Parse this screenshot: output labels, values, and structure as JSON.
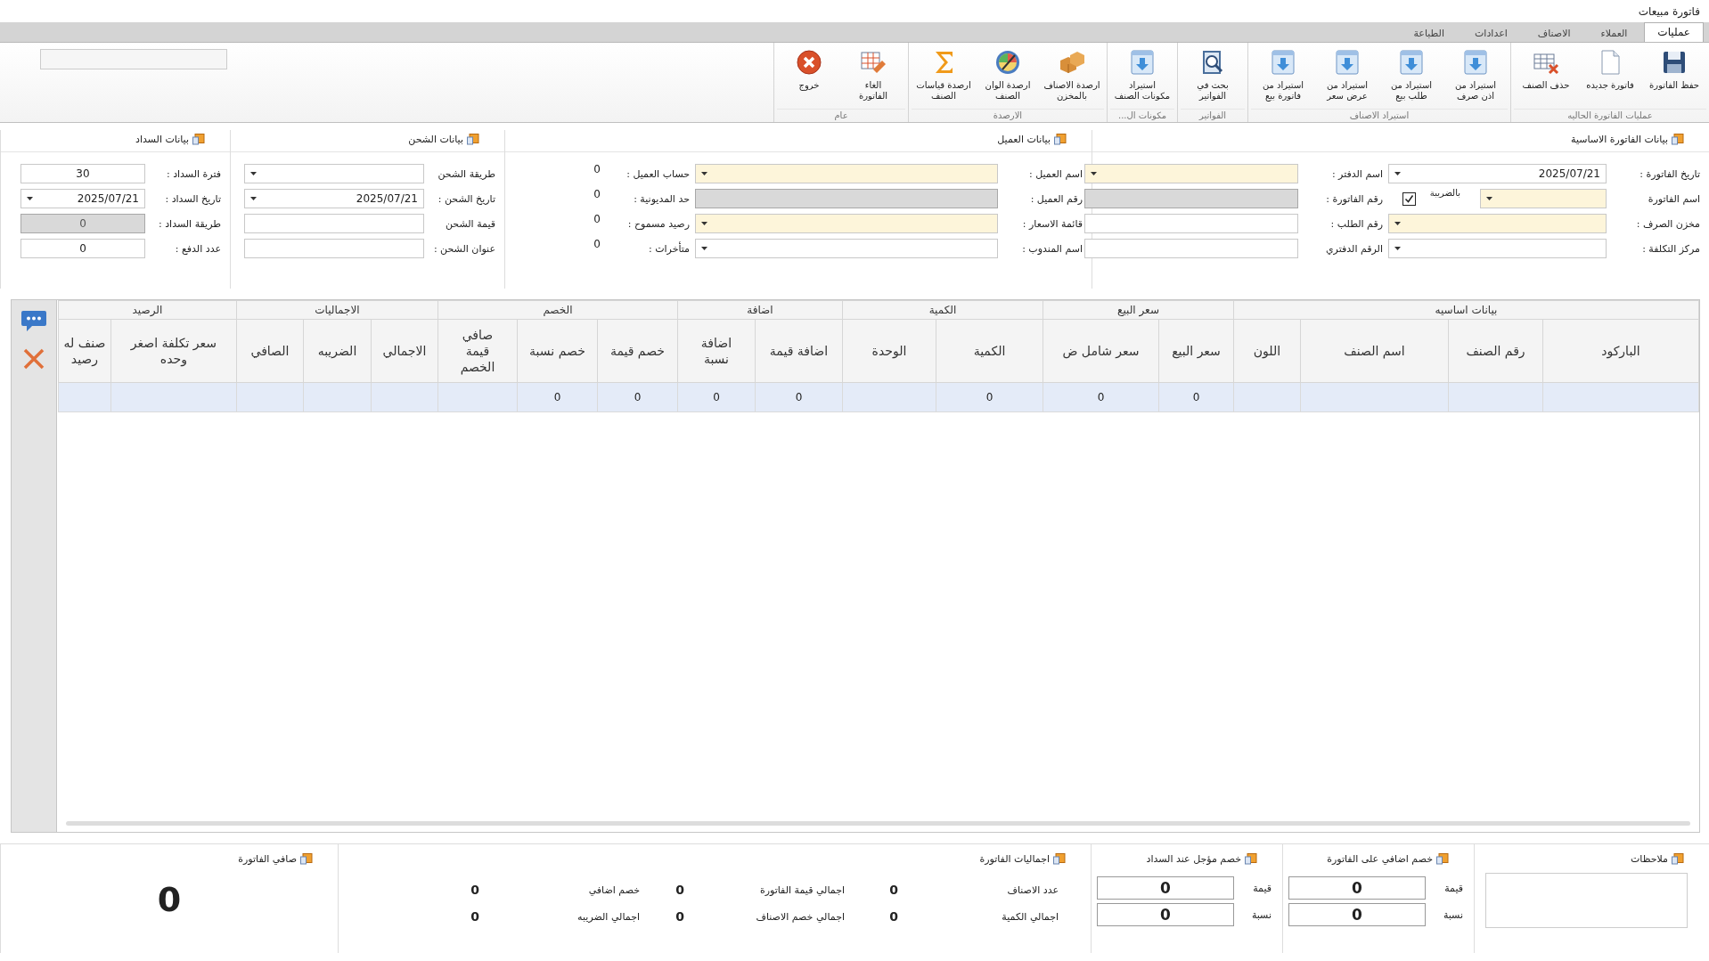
{
  "window": {
    "title": "فاتورة مبيعات"
  },
  "ribbon_tabs": [
    {
      "label": "عمليات",
      "selected": true
    },
    {
      "label": "العملاء",
      "selected": false
    },
    {
      "label": "الاصناف",
      "selected": false
    },
    {
      "label": "اعدادات",
      "selected": false
    },
    {
      "label": "الطباعة",
      "selected": false
    }
  ],
  "ribbon_groups": [
    {
      "label": "عمليات الفاتورة الحاليه",
      "buttons": [
        {
          "label": "حفظ الفاتورة",
          "kind": "save"
        },
        {
          "label": "فاتورة جديده",
          "kind": "new"
        },
        {
          "label": "حذف الصنف",
          "kind": "delete"
        }
      ]
    },
    {
      "label": "استيراد الاصناف",
      "buttons": [
        {
          "label": "استيراد من\nاذن صرف",
          "kind": "import"
        },
        {
          "label": "استيراد من\nطلب بيع",
          "kind": "import"
        },
        {
          "label": "استيراد من\nعرض سعر",
          "kind": "import"
        },
        {
          "label": "استيراد من\nفاتورة بيع",
          "kind": "import"
        }
      ]
    },
    {
      "label": "الفواتير",
      "buttons": [
        {
          "label": "بحث في\nالفواتير",
          "kind": "search"
        }
      ]
    },
    {
      "label": "مكونات ال...",
      "buttons": [
        {
          "label": "استيراد\nمكونات الصنف",
          "kind": "import"
        }
      ]
    },
    {
      "label": "الارصدة",
      "buttons": [
        {
          "label": "ارصدة الاصناف\nبالمخزن",
          "kind": "stock"
        },
        {
          "label": "ارصدة الوان\nالصنف",
          "kind": "colors"
        },
        {
          "label": "ارصدة قياسات\nالصنف",
          "kind": "sizes"
        }
      ]
    },
    {
      "label": "عام",
      "buttons": [
        {
          "label": "الغاء\nالفاتورة",
          "kind": "cancel"
        },
        {
          "label": "خروج",
          "kind": "exit"
        }
      ]
    }
  ],
  "invoice_basic": {
    "title": "بيانات الفاتورة الاساسية",
    "right_fields": [
      {
        "label": "تاريخ الفاتورة :",
        "kind": "dropdown",
        "value": "2025/07/21",
        "required": false,
        "disabled": false
      },
      {
        "label": "اسم الفاتورة",
        "kind": "dropdown",
        "required": true,
        "disabled": false,
        "tax": {
          "label": "بالضريبة",
          "checked": true
        }
      },
      {
        "label": "مخزن الصرف :",
        "kind": "dropdown",
        "required": true,
        "disabled": false
      },
      {
        "label": "مركز التكلفة :",
        "kind": "dropdown",
        "required": false,
        "disabled": false
      }
    ],
    "left_fields": [
      {
        "label": "اسم الدفتر :",
        "kind": "dropdown",
        "required": true,
        "disabled": false
      },
      {
        "label": "رقم الفاتورة :",
        "kind": "text",
        "required": false,
        "disabled": true
      },
      {
        "label": "رقم الطلب :",
        "kind": "text",
        "required": false,
        "disabled": false
      },
      {
        "label": "الرقم الدفتري",
        "kind": "text",
        "required": false,
        "disabled": false
      }
    ]
  },
  "customer": {
    "title": "بيانات العميل",
    "rows": [
      {
        "label": "اسم العميل :",
        "kind": "dropdown",
        "required": true,
        "disabled": false,
        "info_label": "حساب العميل :",
        "info_value": "0"
      },
      {
        "label": "رقم العميل :",
        "kind": "text",
        "required": false,
        "disabled": true,
        "info_label": "حد المديونية :",
        "info_value": "0"
      },
      {
        "label": "قائمة الاسعار :",
        "kind": "dropdown",
        "required": true,
        "disabled": false,
        "info_label": "رصيد مسموح :",
        "info_value": "0"
      },
      {
        "label": "اسم المندوب :",
        "kind": "dropdown",
        "required": false,
        "disabled": false,
        "info_label": "متأخرات :",
        "info_value": "0"
      }
    ]
  },
  "shipping": {
    "title": "بيانات الشحن",
    "fields": [
      {
        "label": "طريقة الشحن",
        "kind": "dropdown",
        "required": false,
        "disabled": false
      },
      {
        "label": "تاريخ الشحن :",
        "kind": "dropdown",
        "value": "2025/07/21",
        "required": false,
        "disabled": false
      },
      {
        "label": "قيمة الشحن",
        "kind": "text",
        "required": false,
        "disabled": false
      },
      {
        "label": "عنوان الشحن :",
        "kind": "text",
        "required": false,
        "disabled": false
      }
    ]
  },
  "payment": {
    "title": "بيانات السداد",
    "fields": [
      {
        "label": "فترة السداد :",
        "kind": "text",
        "value": "30",
        "required": false,
        "disabled": false
      },
      {
        "label": "تاريخ السداد :",
        "kind": "dropdown",
        "value": "2025/07/21",
        "required": false,
        "disabled": false
      },
      {
        "label": "طريقة السداد :",
        "kind": "text",
        "value": "0",
        "required": false,
        "disabled": true
      },
      {
        "label": "عدد الدفع :",
        "kind": "text",
        "value": "0",
        "required": false,
        "disabled": false
      }
    ]
  },
  "table": {
    "groups": [
      {
        "label": "بيانات اساسيه",
        "columns": [
          "الباركود",
          "رقم الصنف",
          "اسم الصنف",
          "اللون"
        ]
      },
      {
        "label": "سعر البيع",
        "columns": [
          "سعر البيع",
          "سعر شامل ض"
        ]
      },
      {
        "label": "الكمية",
        "columns": [
          "الكمية",
          "الوحدة"
        ]
      },
      {
        "label": "اضافة",
        "columns": [
          "اضافة قيمة",
          "اضافة\nنسبة"
        ]
      },
      {
        "label": "الخصم",
        "columns": [
          "خصم قيمة",
          "خصم نسبة",
          "صافي\nقيمة\nالخصم"
        ]
      },
      {
        "label": "الاجماليات",
        "columns": [
          "الاجمالي",
          "الضريبه",
          "الصافي"
        ]
      },
      {
        "label": "الرصيد",
        "columns": [
          "سعر تكلفة اصغر\nوحده",
          "صنف له\nرصيد"
        ]
      }
    ],
    "rows": [
      {
        "selected": true,
        "cells": [
          "",
          "",
          "",
          "",
          "0",
          "0",
          "0",
          "",
          "0",
          "0",
          "0",
          "0",
          "",
          "",
          "",
          "",
          "",
          ""
        ]
      }
    ]
  },
  "notes": {
    "title": "ملاحظات"
  },
  "extra_discount": {
    "title": "خصم اضافي على الفاتورة",
    "fields": [
      {
        "label": "قيمة",
        "value": "0"
      },
      {
        "label": "نسبة",
        "value": "0"
      }
    ]
  },
  "deferred_discount": {
    "title": "خصم مؤجل عند السداد",
    "fields": [
      {
        "label": "قيمة",
        "value": "0"
      },
      {
        "label": "نسبة",
        "value": "0"
      }
    ]
  },
  "totals": {
    "title": "اجماليات الفاتورة",
    "items": [
      {
        "label": "عدد الاصناف",
        "value": "0"
      },
      {
        "label": "اجمالي قيمة الفاتورة",
        "value": "0"
      },
      {
        "label": "خصم اضافي",
        "value": "0"
      },
      {
        "label": "اجمالي الكمية",
        "value": "0"
      },
      {
        "label": "اجمالي خصم الاصناف",
        "value": "0"
      },
      {
        "label": "اجمالي الضريبه",
        "value": "0"
      }
    ]
  },
  "net": {
    "title": "صافي الفاتورة",
    "value": "0"
  }
}
